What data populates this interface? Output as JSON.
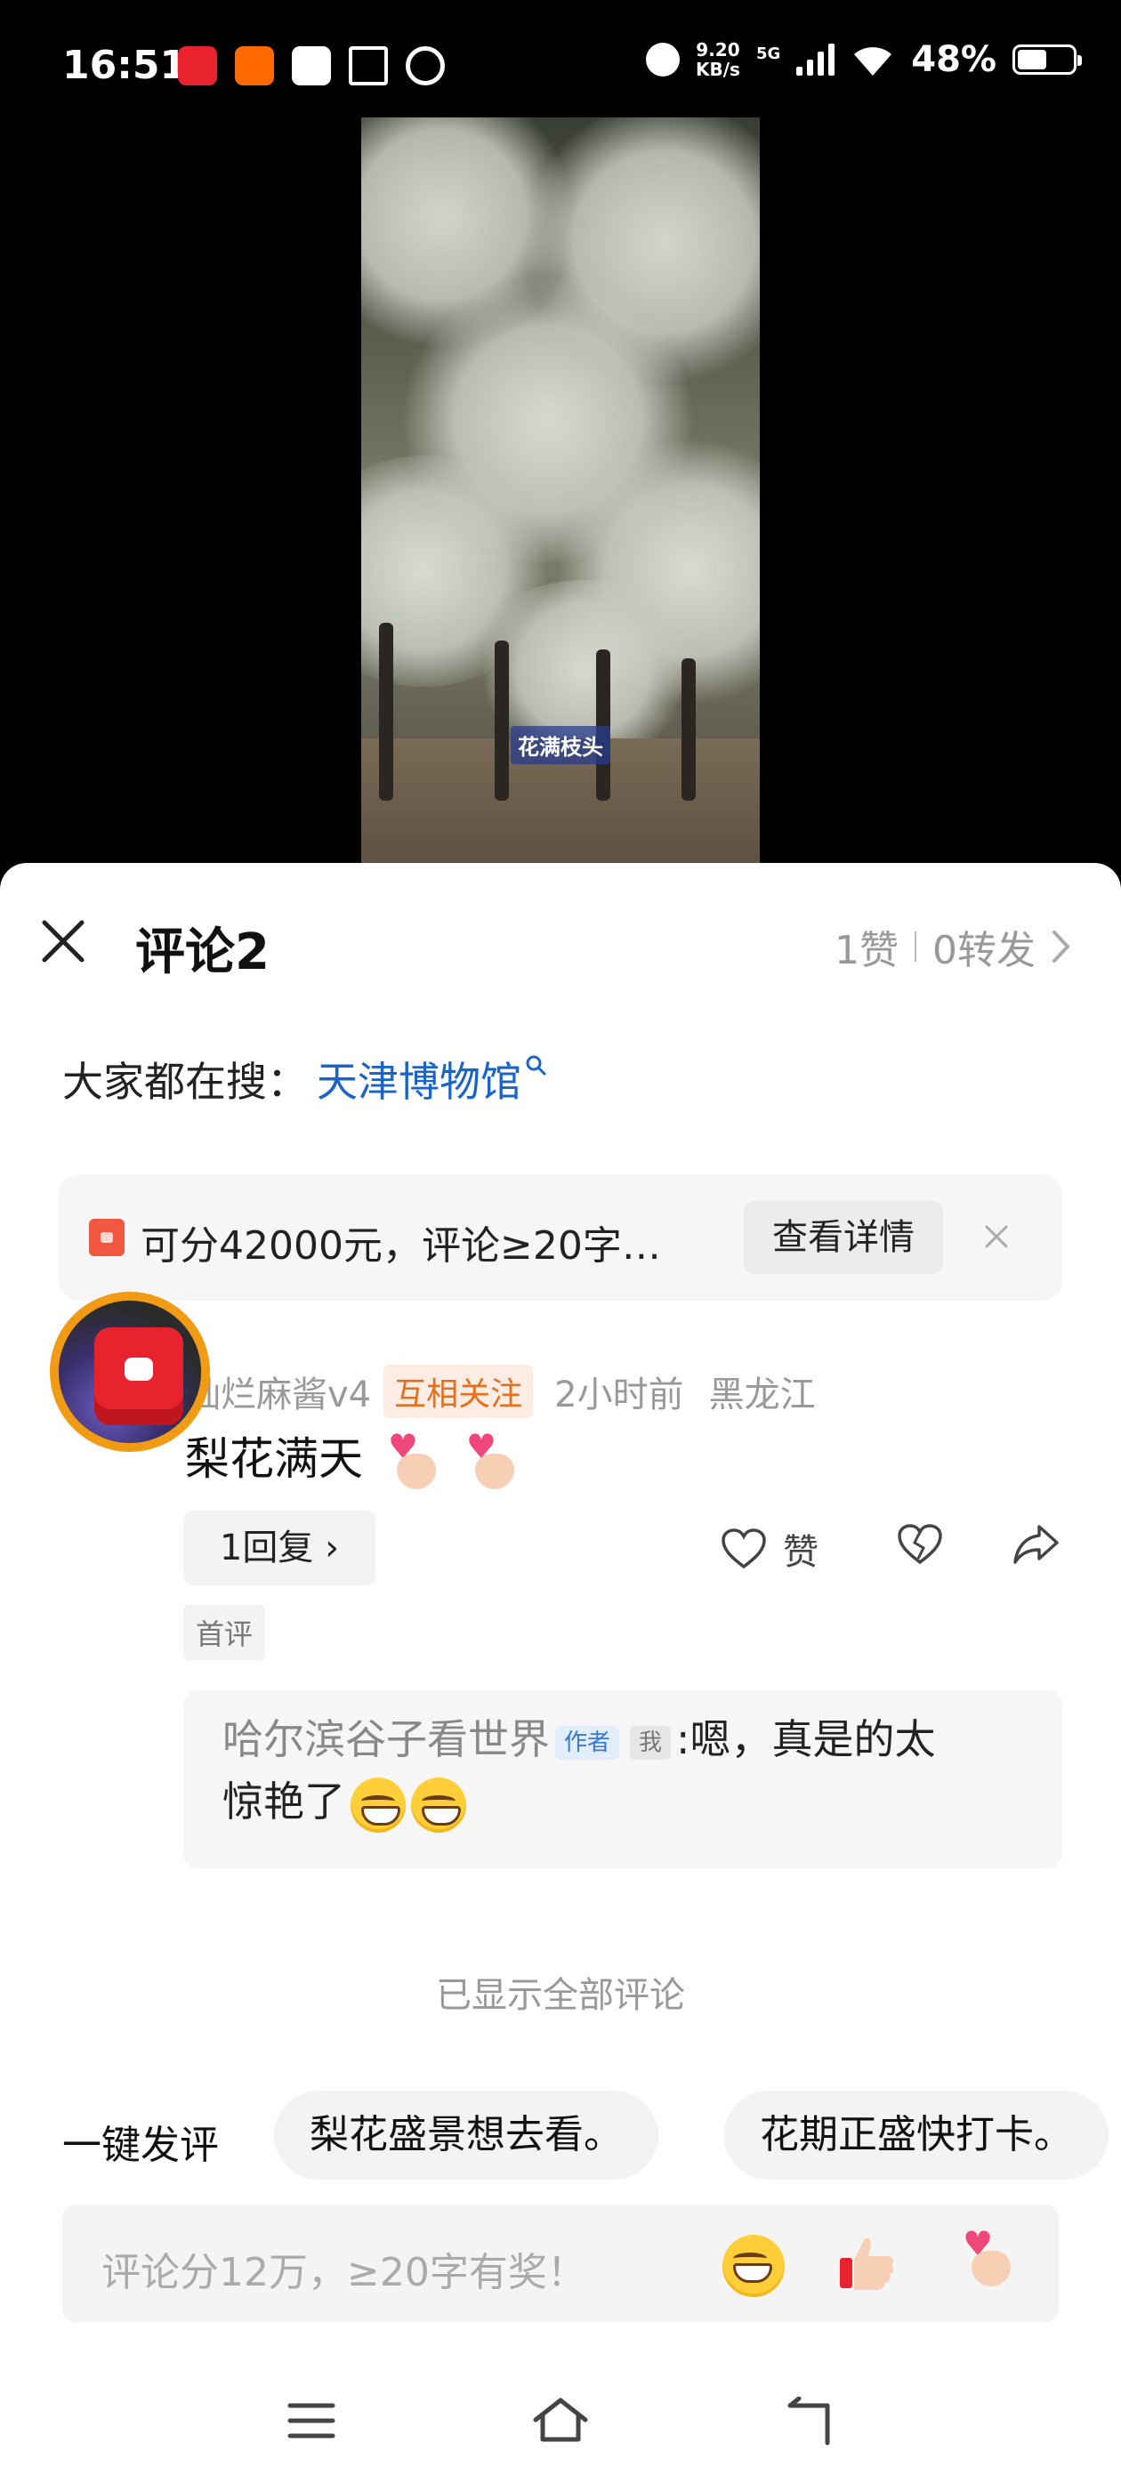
{
  "status_bar": {
    "time": "16:51",
    "speed_value": "9.20",
    "speed_unit": "KB/s",
    "network": "5G",
    "battery": "48%",
    "battery_fraction": 0.48
  },
  "video": {
    "caption": "花满枝头"
  },
  "comments_panel": {
    "title": "评论2",
    "likes": "1赞",
    "shares": "0转发",
    "search_prefix": "大家都在搜：",
    "search_link": "天津博物馆",
    "promo_text": "可分42000元，评论≥20字…",
    "promo_button": "查看详情"
  },
  "comment": {
    "author": "灿烂麻酱v4",
    "badge": "互相关注",
    "time": "2小时前",
    "location": "黑龙江",
    "text": "梨花满天",
    "reply_button": "1回复 ›",
    "like_label": "赞",
    "first_tag": "首评"
  },
  "reply": {
    "author": "哈尔滨谷子看世界",
    "author_tag": "作者",
    "me_tag": "我",
    "text_line1": ":嗯，真是的太",
    "text_line2": "惊艳了"
  },
  "footer": {
    "all_shown": "已显示全部评论",
    "quick_label": "一键发评",
    "quick_1": "梨花盛景想去看。",
    "quick_2": "花期正盛快打卡。",
    "input_placeholder": "评论分12万，≥20字有奖！"
  },
  "colors": {
    "accent_link": "#1a64c8",
    "badge_orange": "#e4701e",
    "avatar_ring": "#f19a14"
  }
}
